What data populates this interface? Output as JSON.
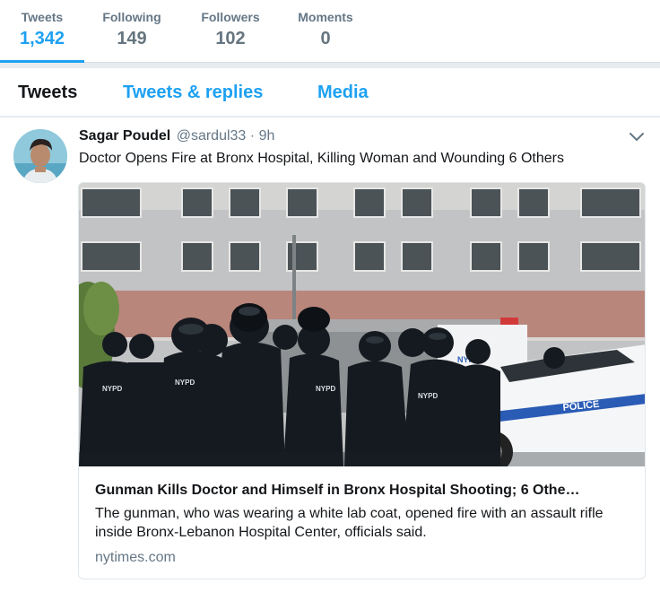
{
  "profile_stats": [
    {
      "label": "Tweets",
      "value": "1,342"
    },
    {
      "label": "Following",
      "value": "149"
    },
    {
      "label": "Followers",
      "value": "102"
    },
    {
      "label": "Moments",
      "value": "0"
    }
  ],
  "tabs": [
    "Tweets",
    "Tweets & replies",
    "Media"
  ],
  "tweet": {
    "fullname": "Sagar Poudel",
    "handle": "@sardul33",
    "separator": "·",
    "time": "9h",
    "text": "Doctor Opens Fire at Bronx Hospital, Killing Woman and Wounding 6 Others",
    "card": {
      "title": "Gunman Kills Doctor and Himself in Bronx Hospital Shooting; 6 Othe…",
      "description": "The gunman, who was wearing a white lab coat, opened fire with an assault rifle inside Bronx-Lebanon Hospital Center, officials said.",
      "domain": "nytimes.com",
      "photo_texts": [
        "NYPD",
        "NYPD",
        "NYPD",
        "NYPD",
        "POLICE",
        "NYPD POLICE"
      ]
    }
  },
  "colors": {
    "accent": "#1da1f2",
    "text_primary": "#14171a",
    "text_secondary": "#657786",
    "background": "#e6ecf0"
  },
  "icons": {
    "caret": "chevron-down-icon",
    "avatar": "avatar"
  }
}
